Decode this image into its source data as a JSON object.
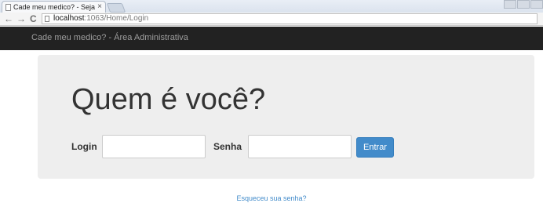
{
  "browser": {
    "tab_title": "Cade meu medico? - Seja",
    "tab_close": "×",
    "url_host": "localhost",
    "url_rest": ":1063/Home/Login",
    "back_glyph": "←",
    "forward_glyph": "→",
    "reload_glyph": "C"
  },
  "navbar": {
    "brand": "Cade meu medico? - Área Administrativa"
  },
  "login": {
    "heading": "Quem é você?",
    "login_label": "Login",
    "login_value": "",
    "password_label": "Senha",
    "password_value": "",
    "submit_label": "Entrar"
  },
  "footer": {
    "forgot_link": "Esqueceu sua senha?"
  },
  "colors": {
    "navbar_bg": "#222222",
    "jumbotron_bg": "#eeeeee",
    "primary": "#428bca",
    "brand_text": "#9d9d9d"
  },
  "icons": {
    "tab_icon": "page-icon",
    "tab_close_icon": "close-icon",
    "back_icon": "arrow-left-icon",
    "forward_icon": "arrow-right-icon",
    "reload_icon": "reload-icon",
    "url_page_icon": "page-icon"
  }
}
